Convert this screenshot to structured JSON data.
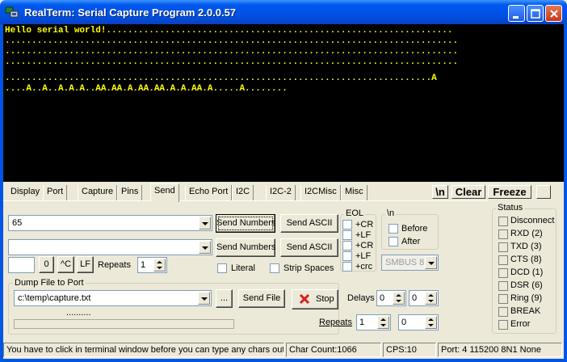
{
  "window": {
    "title": "RealTerm: Serial Capture Program 2.0.0.57"
  },
  "terminal": {
    "lines": [
      "Hello serial world!.................................................................",
      ".....................................................................................",
      ".....................................................................................",
      ".....................................................................................",
      "................................................................................A",
      "....A..A..A.A.A..AA.AA.A.AA.AA.A.A.AA.A.....A........"
    ],
    "text_color": "#FFFF00"
  },
  "tabs": [
    "Display",
    "Port",
    "Capture",
    "Pins",
    "Send",
    "Echo Port",
    "I2C",
    "I2C-2",
    "I2CMisc",
    "Misc"
  ],
  "active_tab": "Send",
  "right_buttons": {
    "newline": "\\n",
    "clear": "Clear",
    "freeze": "Freeze"
  },
  "send": {
    "row1_value": "65",
    "row2_value": "",
    "send_numbers": "Send Numbers",
    "send_ascii": "Send ASCII",
    "small_field": "",
    "zero_btn": "0",
    "ctrl_btn": "^C",
    "lf_btn": "LF",
    "repeats_label": "Repeats",
    "repeats_value": "1",
    "literal": "Literal",
    "strip_spaces": "Strip Spaces",
    "eol_label": "EOL",
    "eol_items": [
      "+CR",
      "+LF",
      "+CR",
      "+LF",
      "+crc"
    ],
    "newline_label": "\\n",
    "before": "Before",
    "after": "After",
    "smbus": "SMBUS 8"
  },
  "dump": {
    "label": "Dump File to Port",
    "file": "c:\\temp\\capture.txt",
    "browse": "...",
    "send_file": "Send File",
    "stop": "Stop",
    "delays_label": "Delays",
    "delay1": "0",
    "delay2": "0",
    "repeats_label": "Repeats",
    "repeats1": "1",
    "repeats2": "0",
    "progress_dots": ".........."
  },
  "status": {
    "label": "Status",
    "items": [
      "Disconnect",
      "RXD (2)",
      "TXD (3)",
      "CTS (8)",
      "DCD (1)",
      "DSR (6)",
      "Ring (9)",
      "BREAK",
      "Error"
    ]
  },
  "statusbar": {
    "hint": "You have to click in terminal window before you can type any chars out",
    "chars": "Char Count:1066",
    "cps": "CPS:10",
    "port": "Port: 4 115200 8N1 None"
  },
  "colors": {
    "titlebar": "#0058EE",
    "stop_x": "#D42020"
  }
}
